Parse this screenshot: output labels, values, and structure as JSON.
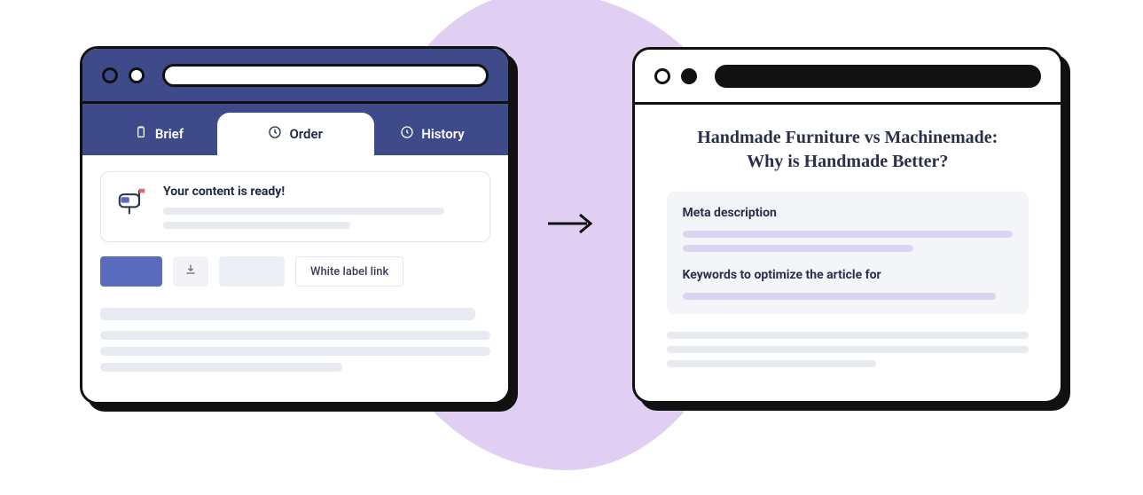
{
  "left": {
    "tabs": {
      "brief": "Brief",
      "order": "Order",
      "history": "History"
    },
    "notice_title": "Your content is ready!",
    "white_label_button": "White label link"
  },
  "right": {
    "article_title": "Handmade Furniture vs Machinemade:\nWhy is Handmade Better?",
    "meta_label": "Meta description",
    "keywords_label": "Keywords to optimize the article for"
  }
}
